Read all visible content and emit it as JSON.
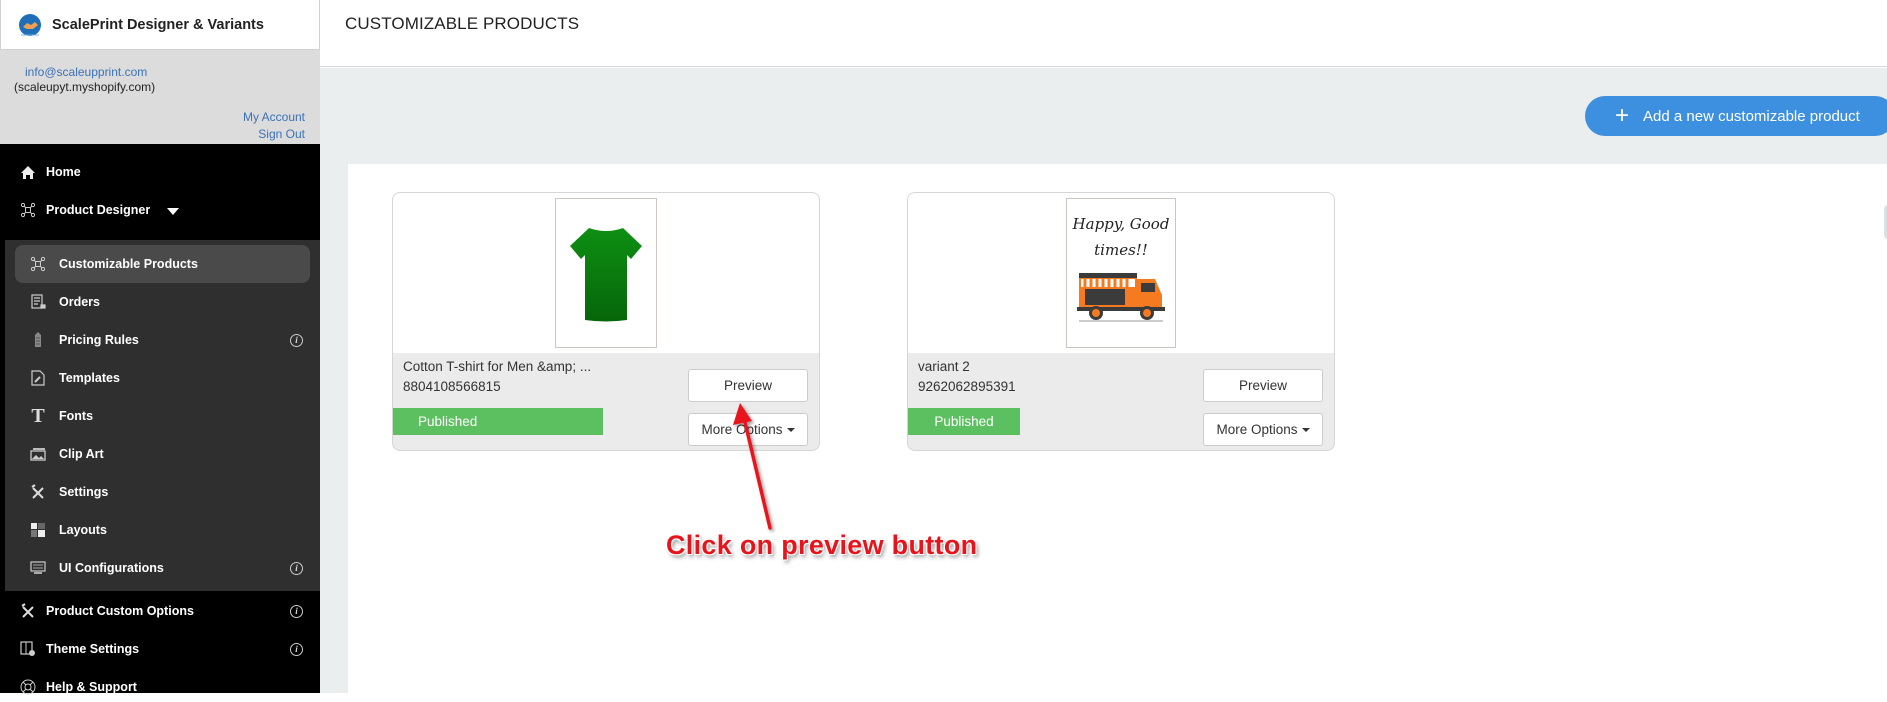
{
  "app": {
    "name": "ScalePrint Designer & Variants",
    "logo_icon": "scaleprint-logo-icon"
  },
  "account": {
    "email": "info@scaleupprint.com",
    "shop": "(scaleupyt.myshopify.com)",
    "my_account": "My Account",
    "sign_out": "Sign Out"
  },
  "sidebar": {
    "top_items": [
      {
        "label": "Home",
        "icon": "home-icon"
      },
      {
        "label": "Product Designer",
        "icon": "network-icon",
        "expanded": true
      }
    ],
    "sub_items": [
      {
        "label": "Customizable Products",
        "icon": "network-icon",
        "active": true,
        "info": false
      },
      {
        "label": "Orders",
        "icon": "orders-icon",
        "info": false
      },
      {
        "label": "Pricing Rules",
        "icon": "price-tag-icon",
        "info": true
      },
      {
        "label": "Templates",
        "icon": "template-edit-icon",
        "info": false
      },
      {
        "label": "Fonts",
        "icon": "font-icon",
        "glyph": "T",
        "info": false
      },
      {
        "label": "Clip Art",
        "icon": "clipart-icon",
        "info": false
      },
      {
        "label": "Settings",
        "icon": "tools-icon",
        "info": false
      },
      {
        "label": "Layouts",
        "icon": "layout-icon",
        "info": false
      },
      {
        "label": "UI Configurations",
        "icon": "ui-config-icon",
        "info": true
      }
    ],
    "bottom_items": [
      {
        "label": "Product Custom Options",
        "icon": "tools-icon",
        "info": true
      },
      {
        "label": "Theme Settings",
        "icon": "theme-settings-icon",
        "info": true
      },
      {
        "label": "Help & Support",
        "icon": "lifebuoy-icon",
        "info": false
      }
    ],
    "info_glyph": "i"
  },
  "header": {
    "title": "CUSTOMIZABLE PRODUCTS"
  },
  "toolbar": {
    "add_label": "Add a new customizable product",
    "add_icon": "+"
  },
  "products": [
    {
      "name": "Cotton T-shirt for Men &amp; ...",
      "id": "8804108566815",
      "status": "Published",
      "preview_label": "Preview",
      "more_label": "More Options",
      "image": "green-tshirt"
    },
    {
      "name": "variant 2",
      "id": "9262062895391",
      "status": "Published",
      "preview_label": "Preview",
      "more_label": "More Options",
      "image": "food-truck-card",
      "image_text_1": "Happy, Good",
      "image_text_2": "times!!"
    }
  ],
  "annotation": {
    "text": "Click on preview button"
  },
  "colors": {
    "accent": "#3d8fdf",
    "published": "#5cbf60",
    "annotation": "#e8141b",
    "sidebar_bg": "#000000",
    "submenu_bg": "#2f2f2f"
  }
}
